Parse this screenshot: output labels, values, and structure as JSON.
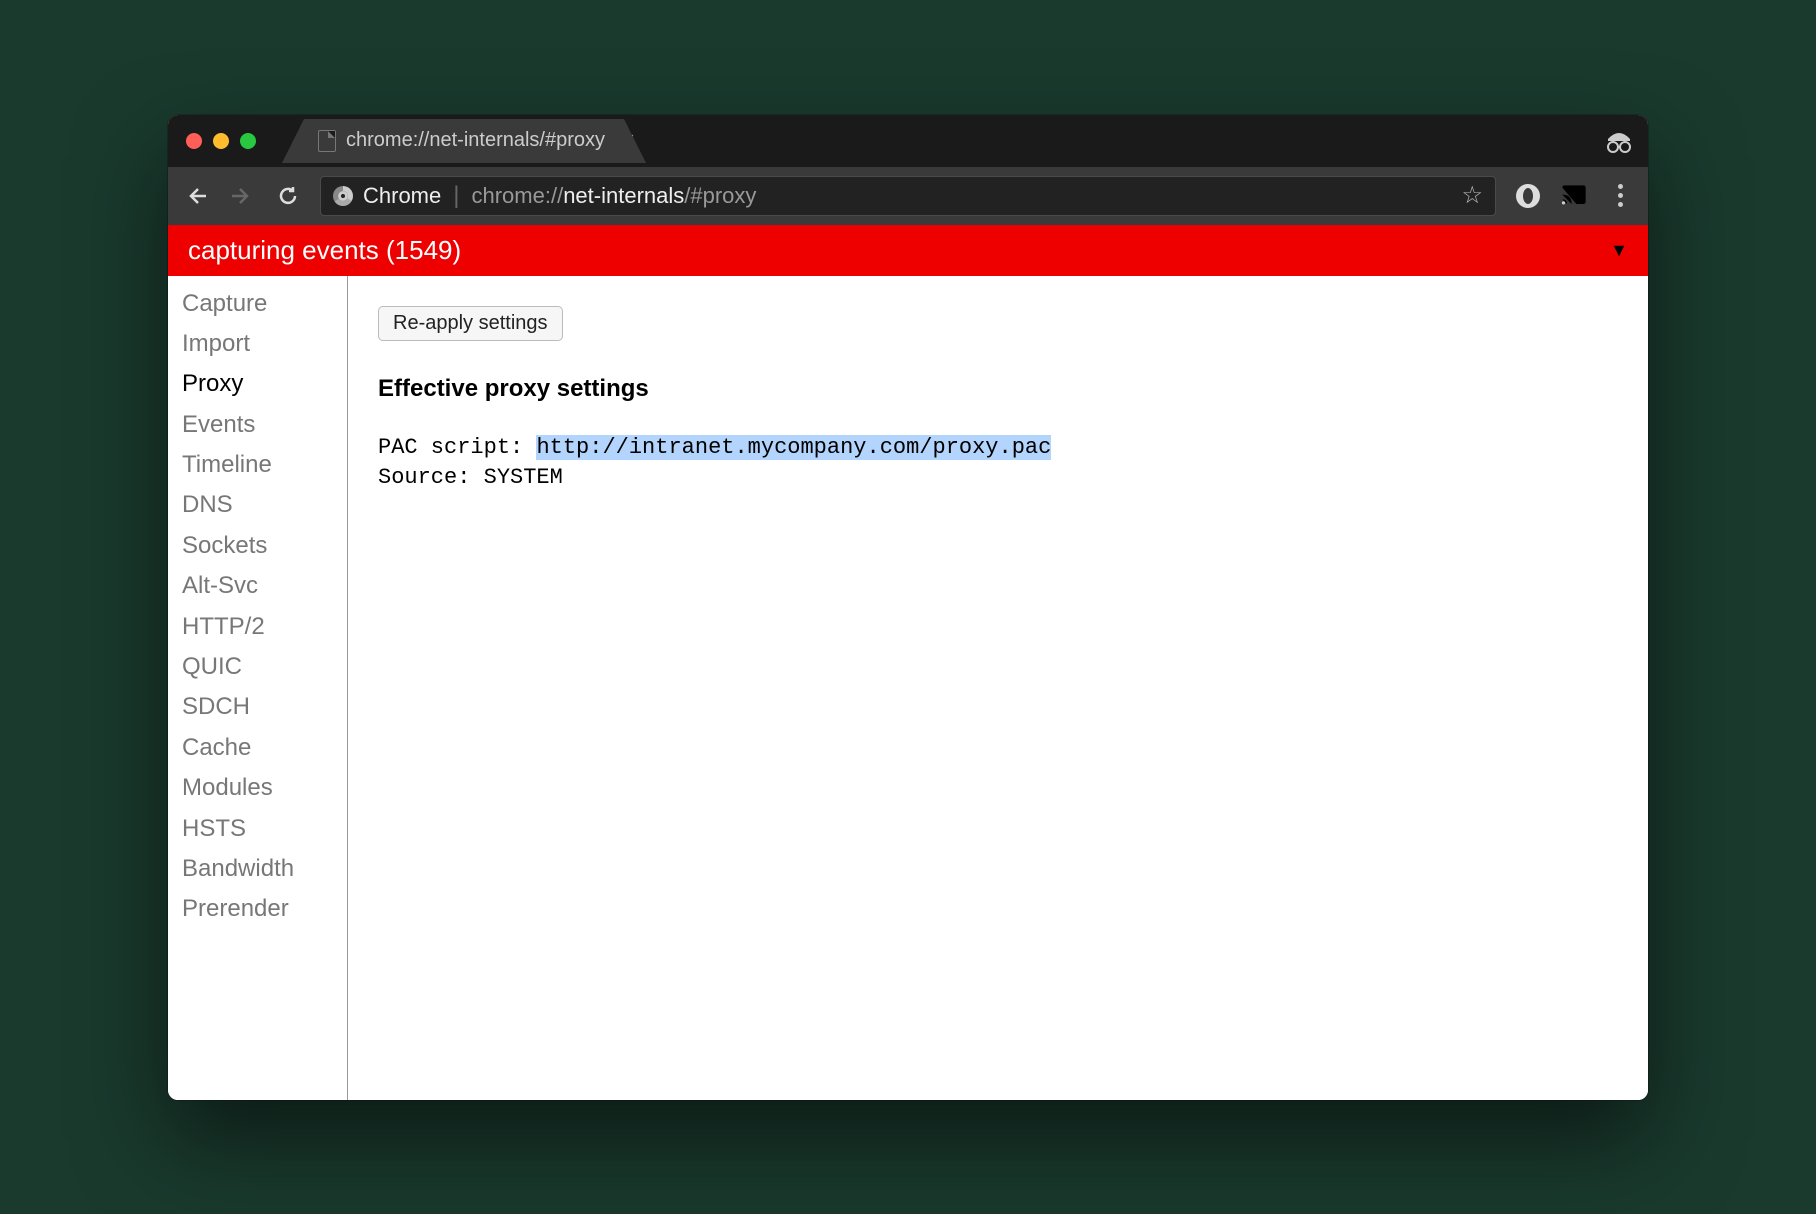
{
  "tab": {
    "title": "chrome://net-internals/#proxy"
  },
  "omnibox": {
    "label": "Chrome",
    "url_prefix": "chrome://",
    "url_host": "net-internals",
    "url_suffix": "/#proxy"
  },
  "banner": {
    "text": "capturing events (1549)"
  },
  "sidebar": {
    "items": [
      {
        "label": "Capture",
        "active": false
      },
      {
        "label": "Import",
        "active": false
      },
      {
        "label": "Proxy",
        "active": true
      },
      {
        "label": "Events",
        "active": false
      },
      {
        "label": "Timeline",
        "active": false
      },
      {
        "label": "DNS",
        "active": false
      },
      {
        "label": "Sockets",
        "active": false
      },
      {
        "label": "Alt-Svc",
        "active": false
      },
      {
        "label": "HTTP/2",
        "active": false
      },
      {
        "label": "QUIC",
        "active": false
      },
      {
        "label": "SDCH",
        "active": false
      },
      {
        "label": "Cache",
        "active": false
      },
      {
        "label": "Modules",
        "active": false
      },
      {
        "label": "HSTS",
        "active": false
      },
      {
        "label": "Bandwidth",
        "active": false
      },
      {
        "label": "Prerender",
        "active": false
      }
    ]
  },
  "content": {
    "reapply_label": "Re-apply settings",
    "heading": "Effective proxy settings",
    "pac_label": "PAC script: ",
    "pac_url": "http://intranet.mycompany.com/proxy.pac",
    "source_line": "Source: SYSTEM"
  }
}
